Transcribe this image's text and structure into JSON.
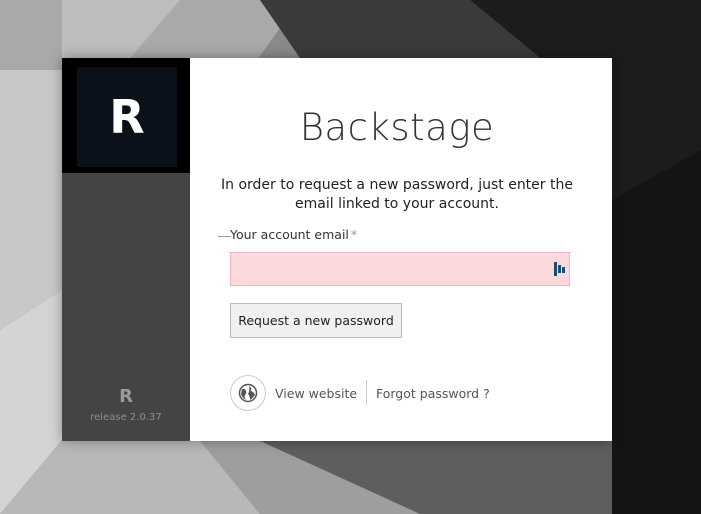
{
  "sidebar": {
    "logo_letter": "R",
    "small_logo_letter": "R",
    "release": "release 2.0.37"
  },
  "main": {
    "title": "Backstage",
    "intro": "In order to request a new password, just enter the email linked to your account.",
    "email_field": {
      "label": "Your account email",
      "required_marker": "*",
      "value": ""
    },
    "submit_label": "Request a new password",
    "view_website_label": "View website",
    "forgot_password_label": "Forgot password ?"
  },
  "colors": {
    "sidebar_bg": "#444444",
    "logo_bg": "#0b111b",
    "input_invalid_bg": "#fadadd",
    "input_invalid_border": "#f0b6c0"
  },
  "icons": [
    "globe-icon",
    "password-manager-icon"
  ]
}
